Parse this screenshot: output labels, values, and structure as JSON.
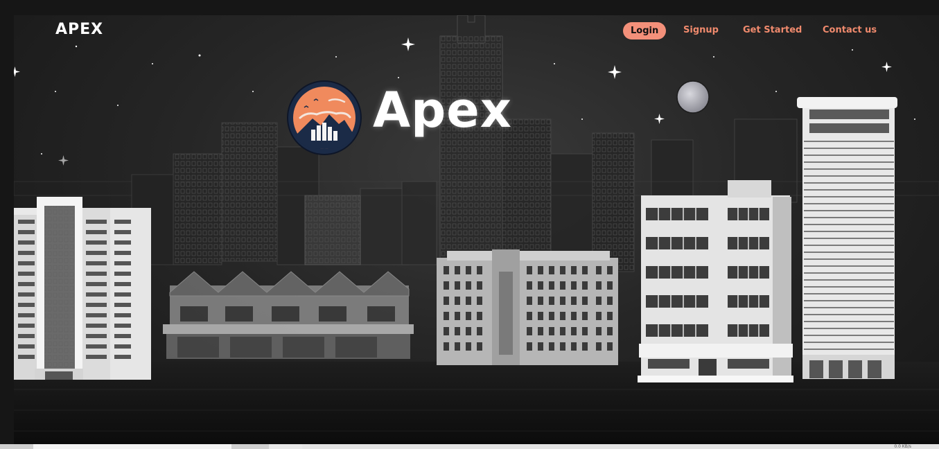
{
  "nav": {
    "brand": "APEX",
    "links": [
      {
        "label": "Login"
      },
      {
        "label": "Signup"
      },
      {
        "label": "Get Started"
      },
      {
        "label": "Contact us"
      }
    ]
  },
  "hero": {
    "title": "Apex",
    "logo_icon": "mountain-sunset-logo"
  },
  "colors": {
    "accent": "#f3907a",
    "accent_text": "#f08a6d",
    "background": "#161616",
    "logo_ring": "#1b2b47",
    "logo_sky": "#f08a5d"
  },
  "statusbar": {
    "text": "0.0 KB/s"
  }
}
